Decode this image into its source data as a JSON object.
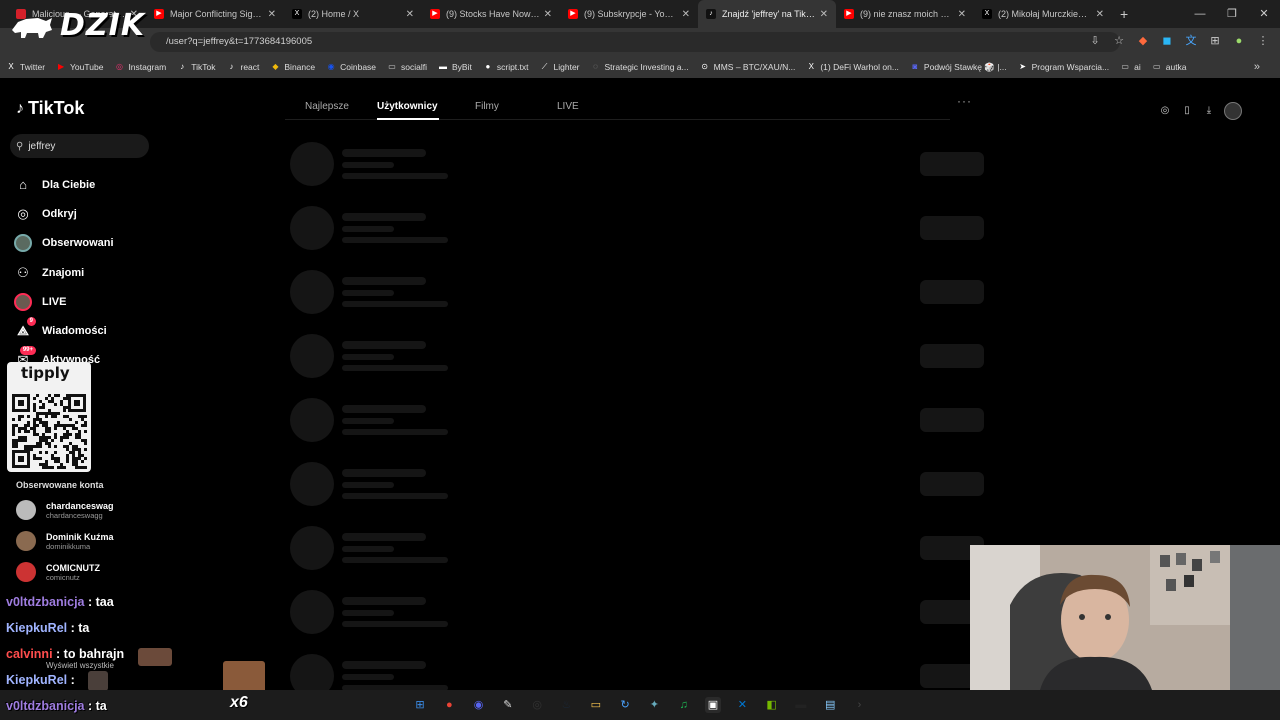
{
  "browser": {
    "tabs": [
      {
        "title": "Malicious — Generated Pro",
        "icon": "red"
      },
      {
        "title": "Major Conflicting Signals",
        "icon": "youtube"
      },
      {
        "title": "(2) Home / X",
        "icon": "x"
      },
      {
        "title": "(9) Stocks Have Now Dropped",
        "icon": "youtube"
      },
      {
        "title": "(9) Subskrypcje - YouTube",
        "icon": "youtube"
      },
      {
        "title": "Znajdź 'jeffrey' na TikTok",
        "icon": "tiktok"
      },
      {
        "title": "(9) nie znasz moich poglądów",
        "icon": "youtube"
      },
      {
        "title": "(2) Mikołaj Murczkiewicz",
        "icon": "x"
      }
    ],
    "active_tab_index": 5,
    "url": "/user?q=jeffrey&t=1773684196005",
    "bookmarks": [
      "Twitter",
      "YouTube",
      "Instagram",
      "TikTok",
      "react",
      "Binance",
      "Coinbase",
      "socialfi",
      "ByBit",
      "script.txt",
      "Lighter",
      "Strategic Investing a...",
      "MMS – BTC/XAU/N...",
      "(1) DeFi Warhol on...",
      "Podwój Stawkę 🎲 |...",
      "Program Wsparcia...",
      "ai",
      "autka"
    ]
  },
  "overlay": {
    "logo_text": "DZIK",
    "tipply_text": "tipply",
    "emote_multiplier": "x6",
    "chat": [
      {
        "user": "v0ltdzbanicja",
        "text": ": taa",
        "color": "#9f7de0"
      },
      {
        "user": "KiepkuRel",
        "text": ": ta",
        "color": "#a0b4ff"
      },
      {
        "user": "calvinni",
        "text": ": to bahrajn",
        "color": "#ff4d4d"
      },
      {
        "user": "KiepkuRel",
        "text": ":",
        "color": "#a0b4ff"
      },
      {
        "user": "v0ltdzbanicja",
        "text": ": ta",
        "color": "#9f7de0"
      }
    ]
  },
  "tiktok": {
    "logo": "TikTok",
    "search_value": "jeffrey",
    "nav": [
      {
        "label": "Dla Ciebie",
        "icon": "home-icon"
      },
      {
        "label": "Odkryj",
        "icon": "compass-icon"
      },
      {
        "label": "Obserwowani",
        "icon": "avatar-icon"
      },
      {
        "label": "Znajomi",
        "icon": "friends-icon"
      },
      {
        "label": "LIVE",
        "icon": "live-icon"
      },
      {
        "label": "Wiadomości",
        "icon": "send-icon",
        "badge": "9"
      },
      {
        "label": "Aktywność",
        "icon": "activity-icon",
        "badge": "99+"
      }
    ],
    "followed_title": "Obserwowane konta",
    "followed": [
      {
        "name": "chardanceswag",
        "handle": "chardanceswagg"
      },
      {
        "name": "Dominik Kuźma",
        "handle": "dominikkuma"
      },
      {
        "name": "COMICNUTZ",
        "handle": "comicnutz"
      }
    ],
    "show_all": "Wyświetl wszystkie",
    "tabs": [
      "Najlepsze",
      "Użytkownicy",
      "Filmy",
      "LIVE"
    ],
    "active_tab": "Użytkownicy"
  },
  "colors": {
    "accent": "#fe2c55",
    "skeleton": "#151515",
    "bg": "#000000"
  }
}
